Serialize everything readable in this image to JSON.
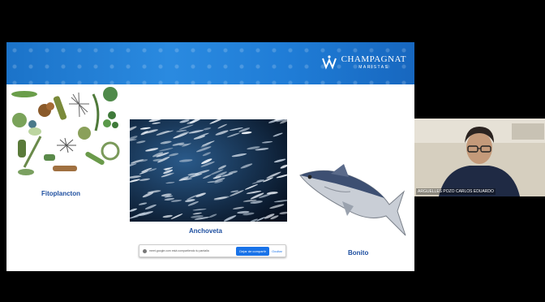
{
  "presentation": {
    "logo": {
      "name": "CHAMPAGNAT",
      "subtitle": "MARISTAS"
    },
    "labels": {
      "phytoplankton": "Fitoplancton",
      "anchovy": "Anchoveta",
      "bonito": "Bonito"
    }
  },
  "share_bar": {
    "text": "meet.google.com está compartiendo tu pantalla",
    "stop_label": "Dejar de compartir",
    "hide_label": "Ocultar"
  },
  "participant": {
    "name": "ARGUELLES POZO CARLOS EDUARDO"
  },
  "colors": {
    "banner": "#1f7cd6",
    "label": "#1e4fa0",
    "stop_button": "#1a73e8"
  }
}
